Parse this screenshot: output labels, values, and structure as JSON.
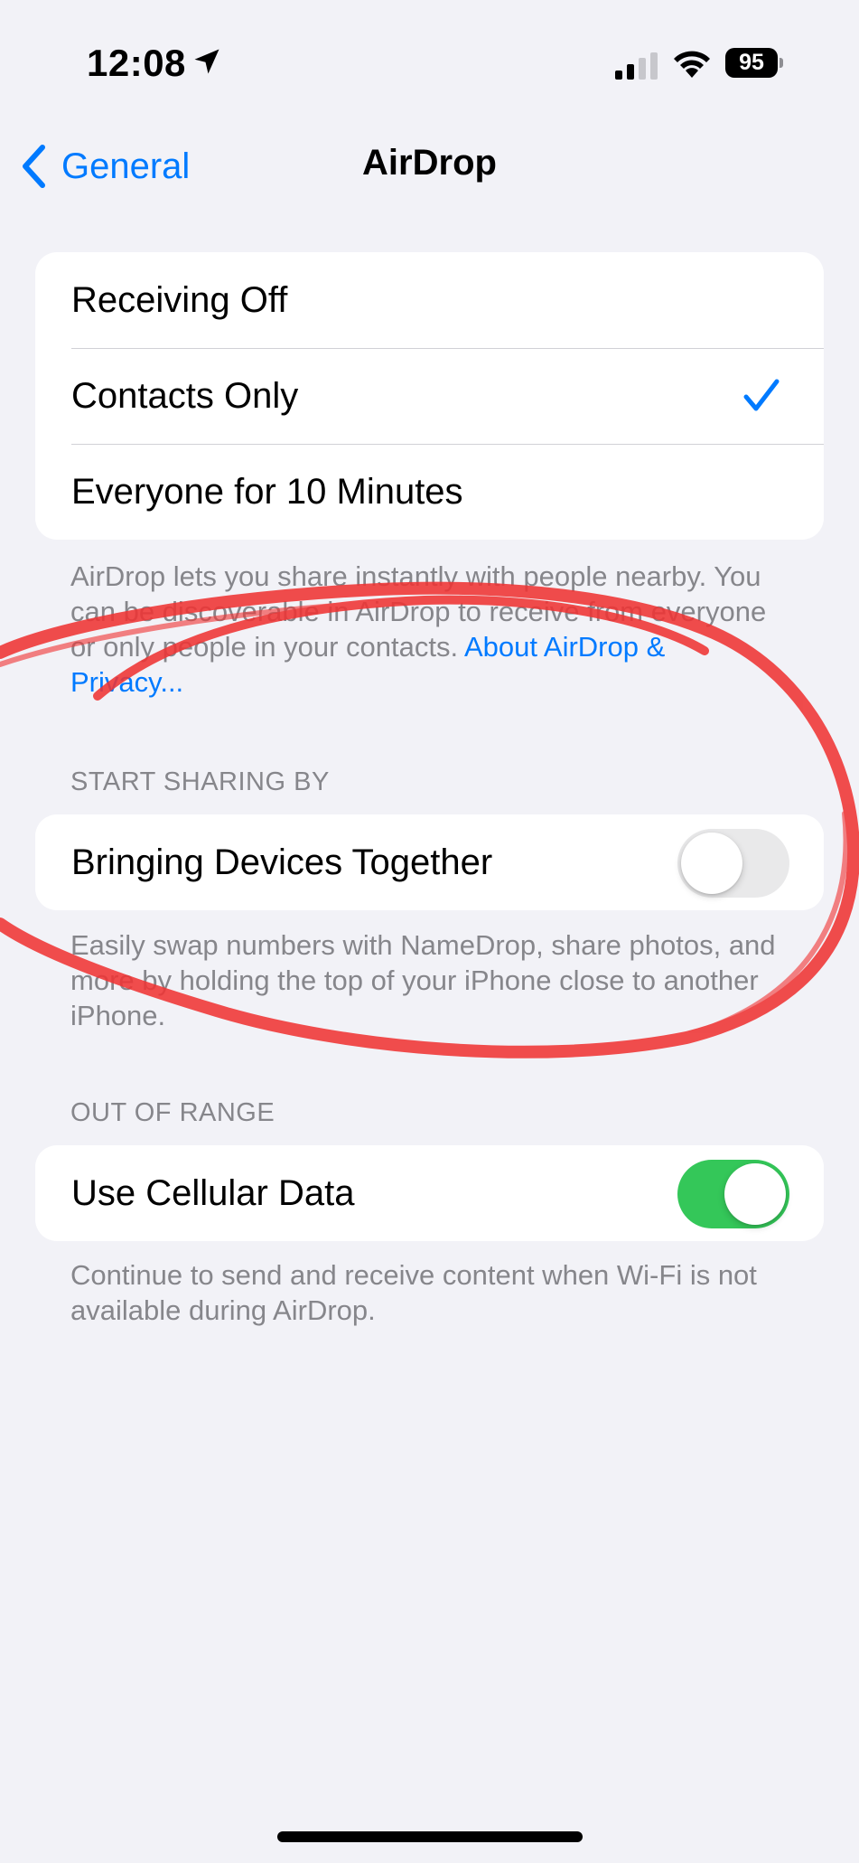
{
  "status_bar": {
    "time": "12:08",
    "battery": "95",
    "icons": [
      "location-arrow-icon",
      "cellular-signal-icon",
      "wifi-icon",
      "battery-icon"
    ]
  },
  "nav": {
    "back_label": "General",
    "title": "AirDrop"
  },
  "receiving": {
    "options": [
      {
        "label": "Receiving Off",
        "selected": false
      },
      {
        "label": "Contacts Only",
        "selected": true
      },
      {
        "label": "Everyone for 10 Minutes",
        "selected": false
      }
    ],
    "footer": "AirDrop lets you share instantly with people nearby. You can be discoverable in AirDrop to receive from everyone or only people in your contacts. ",
    "footer_link": "About AirDrop & Privacy..."
  },
  "start_sharing": {
    "header": "START SHARING BY",
    "row_label": "Bringing Devices Together",
    "toggle_on": false,
    "footer": "Easily swap numbers with NameDrop, share photos, and more by holding the top of your iPhone close to another iPhone."
  },
  "out_of_range": {
    "header": "OUT OF RANGE",
    "row_label": "Use Cellular Data",
    "toggle_on": true,
    "footer": "Continue to send and receive content when Wi-Fi is not available during AirDrop."
  },
  "colors": {
    "background": "#f2f2f7",
    "accent": "#007aff",
    "toggle_on": "#34c759",
    "annotation": "#ef3434"
  }
}
